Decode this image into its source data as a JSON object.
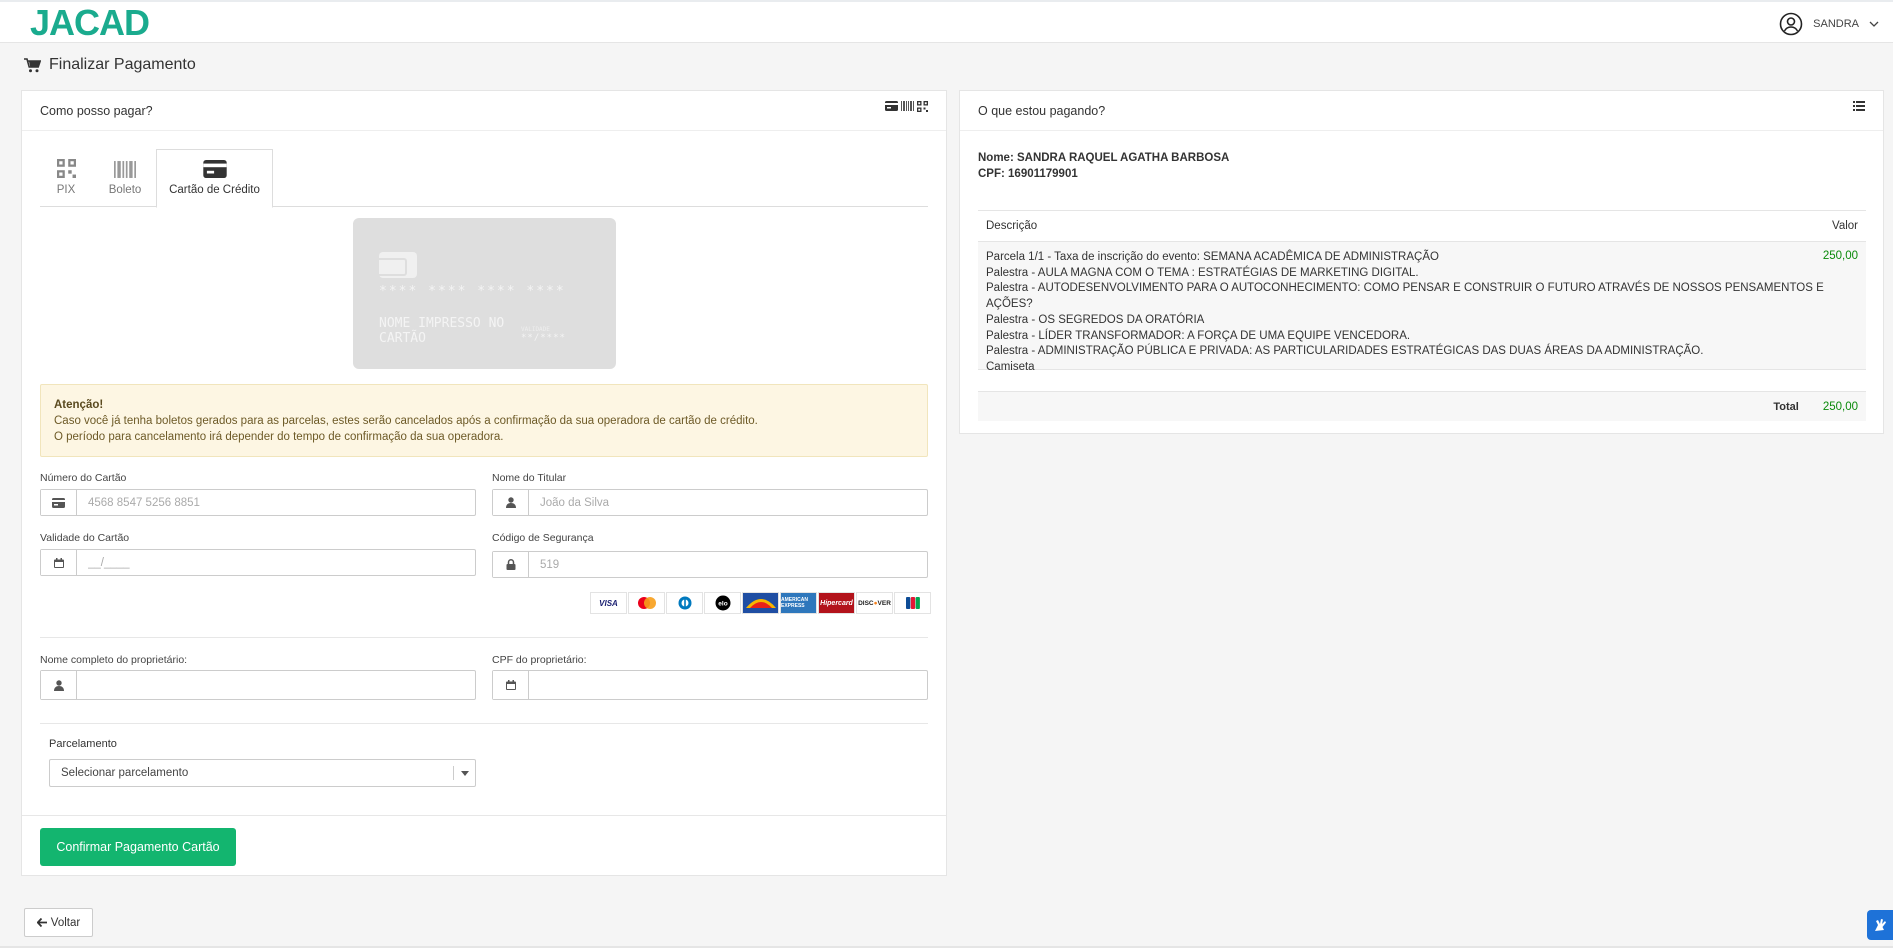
{
  "header": {
    "logo": "JACAD",
    "user_name": "SANDRA"
  },
  "page": {
    "title": "Finalizar Pagamento"
  },
  "payment_panel": {
    "title": "Como posso pagar?",
    "tabs": [
      {
        "label": "PIX",
        "icon": "qrcode-icon"
      },
      {
        "label": "Boleto",
        "icon": "barcode-icon"
      },
      {
        "label": "Cartão de Crédito",
        "icon": "credit-card-icon",
        "active": true
      }
    ],
    "card_preview": {
      "number": "**** **** **** ****",
      "name": "NOME IMPRESSO NO CARTÃO",
      "valid_label": "VALIDADE",
      "valid": "**/****"
    },
    "alert": {
      "title": "Atenção!",
      "line1": "Caso você já tenha boletos gerados para as parcelas, estes serão cancelados após a confirmação da sua operadora de cartão de crédito.",
      "line2": "O período para cancelamento irá depender do tempo de confirmação da sua operadora."
    },
    "fields": {
      "card_number": {
        "label": "Número do Cartão",
        "placeholder": "4568 8547 5256 8851"
      },
      "holder_name": {
        "label": "Nome do Titular",
        "placeholder": "João da Silva"
      },
      "validity": {
        "label": "Validade do Cartão",
        "placeholder": "__/____"
      },
      "security_code": {
        "label": "Código de Segurança",
        "placeholder": "519"
      },
      "owner_name": {
        "label": "Nome completo do proprietário:",
        "placeholder": ""
      },
      "owner_cpf": {
        "label": "CPF do proprietário:",
        "placeholder": ""
      }
    },
    "brands": [
      "VISA",
      "Mastercard",
      "Diners",
      "elo",
      "Aura",
      "American Express",
      "Hipercard",
      "DISCOVER",
      "JCB"
    ],
    "installments": {
      "label": "Parcelamento",
      "selected": "Selecionar parcelamento"
    },
    "confirm_label": "Confirmar Pagamento Cartão"
  },
  "summary_panel": {
    "title": "O que estou pagando?",
    "payer_name": "Nome: SANDRA RAQUEL AGATHA BARBOSA",
    "payer_cpf": "CPF: 16901179901",
    "columns": {
      "description": "Descrição",
      "value": "Valor"
    },
    "items": [
      "Parcela 1/1 - Taxa de inscrição do evento: SEMANA ACADÊMICA DE ADMINISTRAÇÃO",
      "Palestra - AULA MAGNA COM O TEMA : ESTRATÉGIAS DE MARKETING DIGITAL.",
      "Palestra - AUTODESENVOLVIMENTO PARA O AUTOCONHECIMENTO: COMO PENSAR E CONSTRUIR O FUTURO ATRAVÉS DE NOSSOS PENSAMENTOS E AÇÕES?",
      "Palestra - OS SEGREDOS DA ORATÓRIA",
      "Palestra - LÍDER TRANSFORMADOR: A FORÇA DE UMA EQUIPE VENCEDORA.",
      "Palestra - ADMINISTRAÇÃO PÚBLICA E PRIVADA: AS PARTICULARIDADES ESTRATÉGICAS DAS DUAS ÁREAS DA ADMINISTRAÇÃO.",
      "Camiseta"
    ],
    "item_value": "250,00",
    "total_label": "Total",
    "total_value": "250,00"
  },
  "footer": {
    "back_label": "Voltar"
  },
  "colors": {
    "brand": "#1aab8e",
    "confirm": "#13b56f",
    "value_green": "#0a8a0a",
    "alert_bg": "#fdf6e3"
  }
}
